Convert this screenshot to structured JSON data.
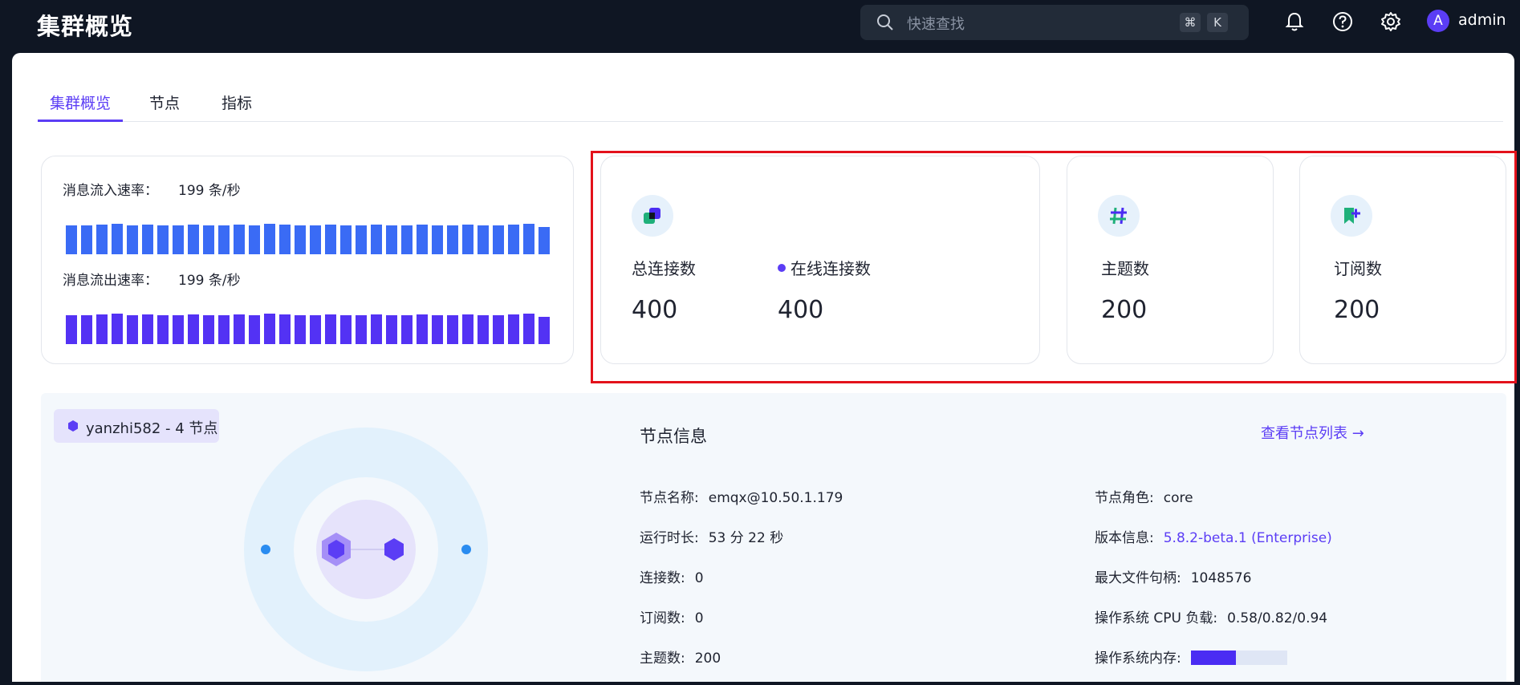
{
  "header": {
    "title": "集群概览",
    "search_placeholder": "快速查找",
    "shortcut_keys": [
      "⌘",
      "K"
    ],
    "username": "admin",
    "avatar_letter": "A"
  },
  "tabs": [
    {
      "label": "集群概览",
      "active": true
    },
    {
      "label": "节点",
      "active": false
    },
    {
      "label": "指标",
      "active": false
    }
  ],
  "rates": {
    "in_label": "消息流入速率：",
    "in_value": "199 条/秒",
    "out_label": "消息流出速率：",
    "out_value": "199 条/秒",
    "in_color": "#3a6bf5",
    "out_color": "#5332f4"
  },
  "metrics": {
    "total_connections_label": "总连接数",
    "total_connections_value": "400",
    "online_connections_label": "在线连接数",
    "online_connections_value": "400",
    "topics_label": "主题数",
    "topics_value": "200",
    "subscriptions_label": "订阅数",
    "subscriptions_value": "200"
  },
  "cluster": {
    "badge": "yanzhi582 - 4 节点"
  },
  "node_info": {
    "title": "节点信息",
    "view_list_link": "查看节点列表 →",
    "left": [
      {
        "key": "节点名称:",
        "value": "emqx@10.50.1.179"
      },
      {
        "key": "运行时长:",
        "value": "53 分 22 秒"
      },
      {
        "key": "连接数:",
        "value": "0"
      },
      {
        "key": "订阅数:",
        "value": "0"
      },
      {
        "key": "主题数:",
        "value": "200"
      }
    ],
    "right": [
      {
        "key": "节点角色:",
        "value": "core"
      },
      {
        "key": "版本信息:",
        "value": "5.8.2-beta.1 (Enterprise)"
      },
      {
        "key": "最大文件句柄:",
        "value": "1048576"
      },
      {
        "key": "操作系统 CPU 负载:",
        "value": "0.58/0.82/0.94"
      },
      {
        "key": "操作系统内存:",
        "value": ""
      }
    ],
    "memory_usage_fraction": 0.47
  },
  "colors": {
    "accent": "#5b3df5",
    "highlight_border": "#e3121b"
  }
}
